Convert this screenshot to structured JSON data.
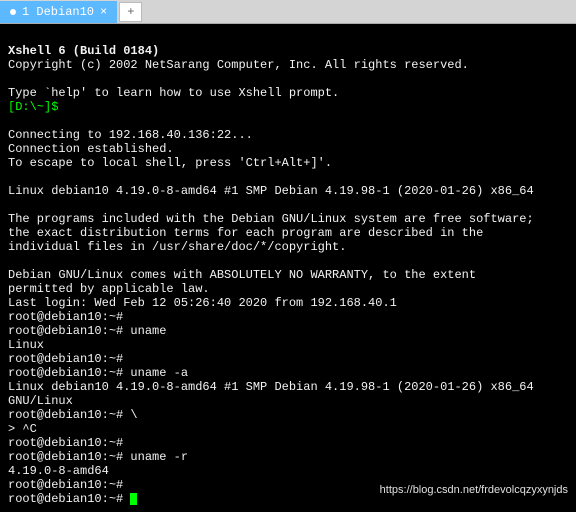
{
  "tabs": {
    "active_label": "1 Debian10",
    "add_label": "+"
  },
  "term": {
    "title": "Xshell 6 (Build 0184)",
    "copyright": "Copyright (c) 2002 NetSarang Computer, Inc. All rights reserved.",
    "help_hint": "Type `help' to learn how to use Xshell prompt.",
    "local_prompt": "[D:\\~]$",
    "connecting": "Connecting to 192.168.40.136:22...",
    "established": "Connection established.",
    "escape_hint": "To escape to local shell, press 'Ctrl+Alt+]'.",
    "uname_line": "Linux debian10 4.19.0-8-amd64 #1 SMP Debian 4.19.98-1 (2020-01-26) x86_64",
    "prog1": "The programs included with the Debian GNU/Linux system are free software;",
    "prog2": "the exact distribution terms for each program are described in the",
    "prog3": "individual files in /usr/share/doc/*/copyright.",
    "warranty1": "Debian GNU/Linux comes with ABSOLUTELY NO WARRANTY, to the extent",
    "warranty2": "permitted by applicable law.",
    "last_login": "Last login: Wed Feb 12 05:26:40 2020 from 192.168.40.1",
    "prompt": "root@debian10:~#",
    "cmd_uname": "uname",
    "out_uname": "Linux",
    "cmd_uname_a": "uname -a",
    "out_uname_a": "Linux debian10 4.19.0-8-amd64 #1 SMP Debian 4.19.98-1 (2020-01-26) x86_64 GNU/Linux",
    "cont_backslash": "\\",
    "cont_prompt": "> ^C",
    "cmd_uname_r": "uname -r",
    "out_uname_r": "4.19.0-8-amd64"
  },
  "watermark": "https://blog.csdn.net/frdevolcqzyxynjds"
}
